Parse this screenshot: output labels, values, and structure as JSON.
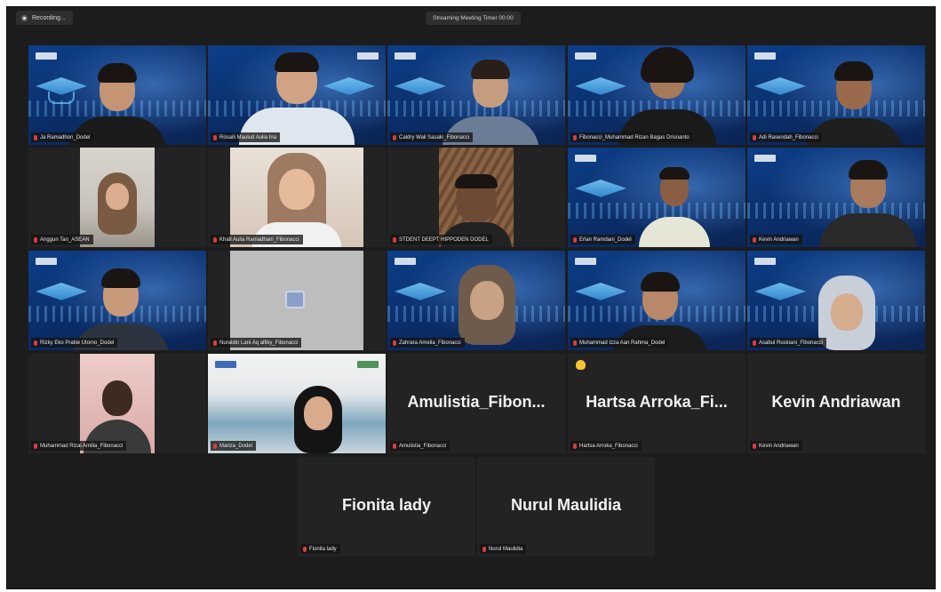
{
  "topbar": {
    "recording_label": "Recording...",
    "meeting_title": "Streaming Meeting Timer 00:00"
  },
  "colors": {
    "window_bg": "#1c1c1c",
    "tile_bg": "#232323",
    "active_speaker": "#c7d94a",
    "muted_mic": "#e03b3b",
    "raised_hand": "#f4c431"
  },
  "participants": [
    {
      "label": "Ja Ramadhon_Dodel"
    },
    {
      "label": "Rosaili Maulud Aulia Ina"
    },
    {
      "label": "Caldry Wali Sasaki_Fibonacci"
    },
    {
      "label": "Fibonacci_Muhammad Rizan Bagas Drisnanto"
    },
    {
      "label": "Adi Rasendah_Fibonacci"
    },
    {
      "label": "Anggun Tan_ASEAN"
    },
    {
      "label": "Khafi Aulia Ramadhani_Fibonacci"
    },
    {
      "label": "STDENT DEEPT HIPPODEN DODEL"
    },
    {
      "label": "Erlan Ramdani_Dodel"
    },
    {
      "label": "Kevin Andriawan"
    },
    {
      "label": "Rizky Eko Pratiw Utomo_Dodel"
    },
    {
      "label": "Nuraldin Lani Aq alfiky_Fibonacci"
    },
    {
      "label": "Zahrara Amelia_Fibonacci"
    },
    {
      "label": "Muhammad Izza Aan Rahma_Dodel"
    },
    {
      "label": "Asabul Ruskiani_Fibonacci"
    },
    {
      "label": "Muhammad Rizai Amilia_Fibonacci"
    },
    {
      "label": "Mariza_Dodel"
    },
    {
      "label": "Amulistia_Fibonacci",
      "display_name": "Amulistia_Fibon..."
    },
    {
      "label": "Hartsa Arroka_Fibonacci",
      "display_name": "Hartsa  Arroka_Fi..."
    },
    {
      "label": "Kevin Andriawan",
      "display_name": "Kevin Andriawan"
    },
    {
      "label": "Fionita lady",
      "display_name": "Fionita lady"
    },
    {
      "label": "Nurul Maulidia",
      "display_name": "Nurul Maulidia"
    }
  ]
}
